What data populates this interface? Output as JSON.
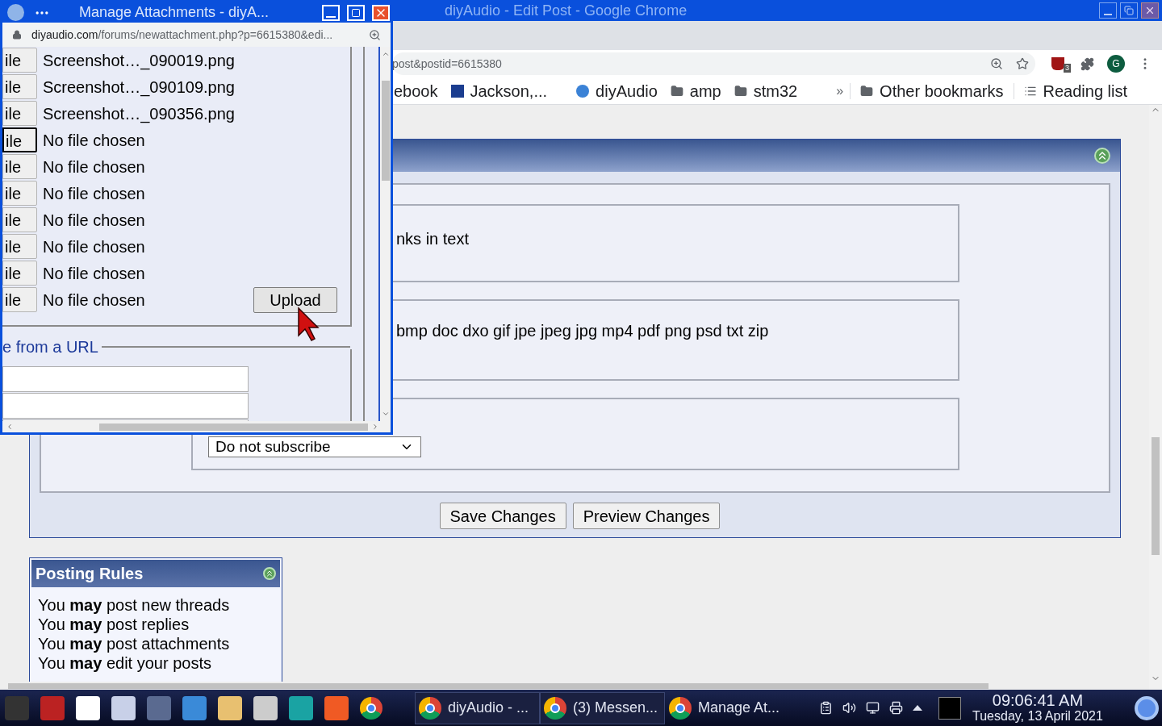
{
  "browser": {
    "title": "diyAudio - Edit Post - Google Chrome",
    "address": "post&postid=6615380",
    "extension_badge": "3",
    "profile": "G",
    "bookmarks": [
      {
        "label": "ebook",
        "kind": "page"
      },
      {
        "label": "Jackson,...",
        "kind": "weather"
      },
      {
        "label": "diyAudio",
        "kind": "site"
      },
      {
        "label": "amp",
        "kind": "folder"
      },
      {
        "label": "stm32",
        "kind": "folder"
      }
    ],
    "overflow": "»",
    "other_bookmarks": "Other bookmarks",
    "reading_list": "Reading list"
  },
  "page": {
    "fieldsets": [
      {
        "kind": "text",
        "text": "nks in text"
      },
      {
        "kind": "text",
        "text": "bmp doc dxo gif jpe jpeg jpg mp4 pdf png psd txt zip"
      },
      {
        "kind": "select",
        "text": "Do not subscribe"
      }
    ],
    "buttons": [
      "Save Changes",
      "Preview Changes"
    ],
    "posting_rules": {
      "title": "Posting Rules",
      "rules": [
        "You **may** post new threads",
        "You **may** post replies",
        "You **may** post attachments",
        "You **may** edit your posts"
      ]
    }
  },
  "popup": {
    "title": "Manage Attachments - diyA...",
    "domain": "diyaudio.com",
    "path": "/forums/newattachment.php?p=6615380&edi...",
    "files": [
      {
        "button": "ile",
        "name": "Screenshot…_090019.png",
        "focused": false
      },
      {
        "button": "ile",
        "name": "Screenshot…_090109.png",
        "focused": false
      },
      {
        "button": "ile",
        "name": "Screenshot…_090356.png",
        "focused": false
      },
      {
        "button": "ile",
        "name": "No file chosen",
        "focused": true
      },
      {
        "button": "ile",
        "name": "No file chosen",
        "focused": false
      },
      {
        "button": "ile",
        "name": "No file chosen",
        "focused": false
      },
      {
        "button": "ile",
        "name": "No file chosen",
        "focused": false
      },
      {
        "button": "ile",
        "name": "No file chosen",
        "focused": false
      },
      {
        "button": "ile",
        "name": "No file chosen",
        "focused": false
      },
      {
        "button": "ile",
        "name": "No file chosen",
        "focused": false
      }
    ],
    "upload": "Upload",
    "url_legend": "e from a URL"
  },
  "taskbar": {
    "tasks": [
      {
        "label": "diyAudio - ...",
        "framed": true
      },
      {
        "label": "(3) Messen...",
        "framed": true
      },
      {
        "label": "Manage At...",
        "framed": false
      }
    ],
    "time": "09:06:41 AM",
    "date": "Tuesday, 13 April 2021"
  }
}
